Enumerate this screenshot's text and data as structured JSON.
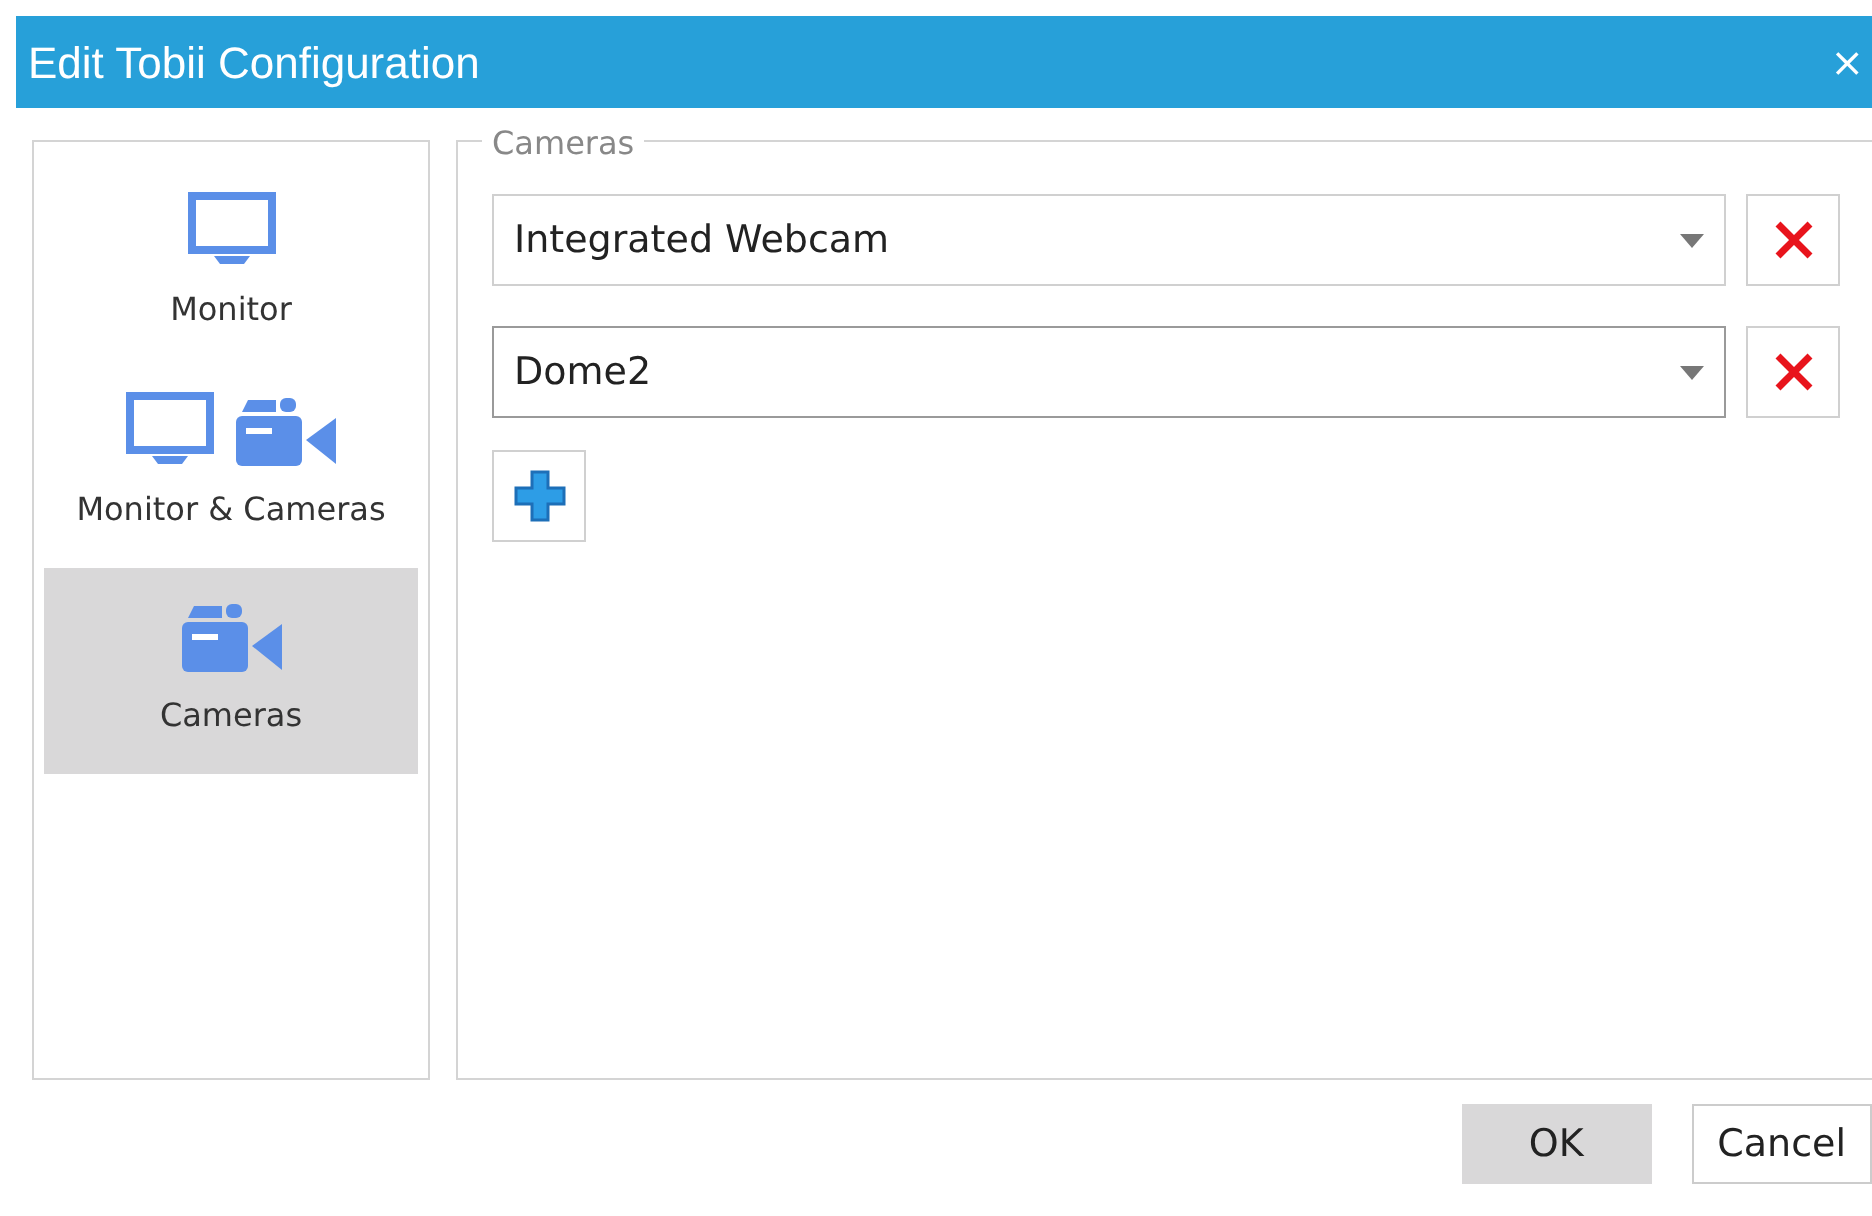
{
  "window": {
    "title": "Edit Tobii Configuration",
    "close": "×"
  },
  "sidebar": {
    "items": [
      {
        "kind": "monitor",
        "label": "Monitor",
        "selected": false
      },
      {
        "kind": "monitor_camera",
        "label": "Monitor & Cameras",
        "selected": false
      },
      {
        "kind": "camera",
        "label": "Cameras",
        "selected": true
      }
    ]
  },
  "cameras": {
    "legend": "Cameras",
    "rows": [
      {
        "value": "Integrated Webcam",
        "focused": false
      },
      {
        "value": "Dome2",
        "focused": true
      }
    ]
  },
  "buttons": [
    {
      "label": "OK",
      "kind": "default"
    },
    {
      "label": "Cancel",
      "kind": "plain"
    }
  ]
}
